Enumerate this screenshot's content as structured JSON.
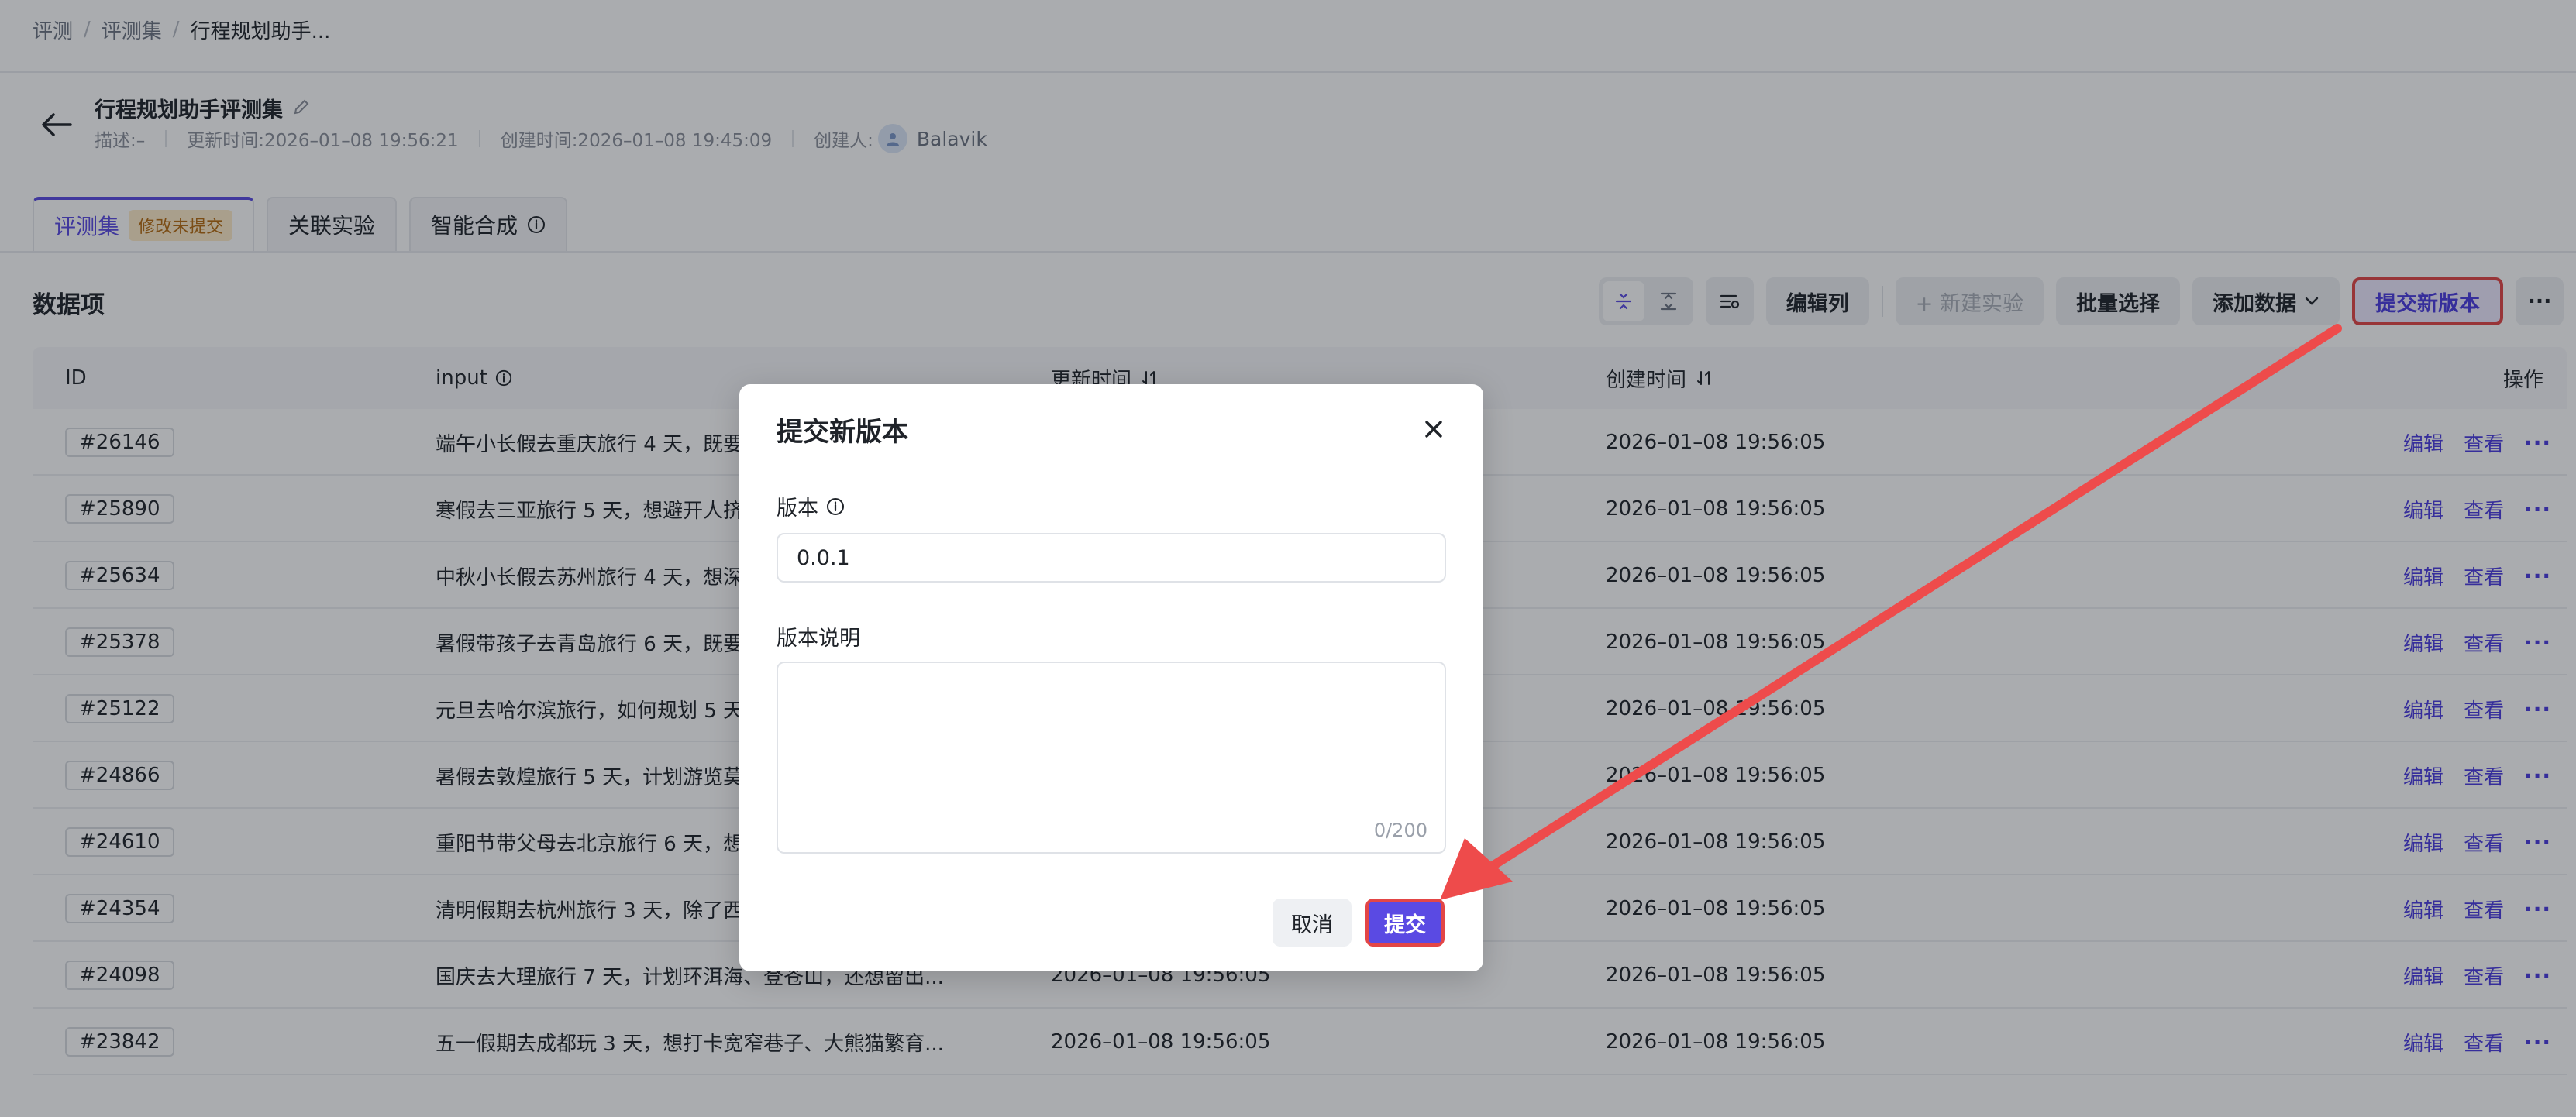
{
  "breadcrumb": {
    "items": [
      "评测",
      "评测集",
      "行程规划助手..."
    ]
  },
  "header": {
    "title": "行程规划助手评测集",
    "description": "描述:–",
    "updated": "更新时间:2026–01–08 19:56:21",
    "created": "创建时间:2026–01–08 19:45:09",
    "creator_label": "创建人:",
    "creator_name": "Balavik"
  },
  "tabs": [
    {
      "label": "评测集",
      "badge": "修改未提交"
    },
    {
      "label": "关联实验"
    },
    {
      "label": "智能合成"
    }
  ],
  "section": {
    "title": "数据项"
  },
  "toolbar": {
    "edit_columns": "编辑列",
    "new_experiment": "+ 新建实验",
    "batch_select": "批量选择",
    "add_data": "添加数据",
    "submit_version": "提交新版本",
    "more": "···"
  },
  "table": {
    "columns": {
      "id": "ID",
      "input": "input",
      "updated": "更新时间",
      "created": "创建时间",
      "actions": "操作"
    },
    "rows": [
      {
        "id": "#26146",
        "input": "端午小长假去重庆旅行 4 天，既要",
        "updated": "",
        "created": "2026–01–08 19:56:05"
      },
      {
        "id": "#25890",
        "input": "寒假去三亚旅行 5 天，想避开人挤",
        "updated": "",
        "created": "2026–01–08 19:56:05"
      },
      {
        "id": "#25634",
        "input": "中秋小长假去苏州旅行 4 天，想深",
        "updated": "",
        "created": "2026–01–08 19:56:05"
      },
      {
        "id": "#25378",
        "input": "暑假带孩子去青岛旅行 6 天，既要",
        "updated": "",
        "created": "2026–01–08 19:56:05"
      },
      {
        "id": "#25122",
        "input": "元旦去哈尔滨旅行，如何规划 5 天",
        "updated": "",
        "created": "2026–01–08 19:56:05"
      },
      {
        "id": "#24866",
        "input": "暑假去敦煌旅行 5 天，计划游览莫",
        "updated": "",
        "created": "2026–01–08 19:56:05"
      },
      {
        "id": "#24610",
        "input": "重阳节带父母去北京旅行 6 天，想",
        "updated": "",
        "created": "2026–01–08 19:56:05"
      },
      {
        "id": "#24354",
        "input": "清明假期去杭州旅行 3 天，除了西",
        "updated": "",
        "created": "2026–01–08 19:56:05"
      },
      {
        "id": "#24098",
        "input": "国庆去大理旅行 7 天，计划环洱海、登苍山，还想留出...",
        "updated": "2026–01–08 19:56:05",
        "created": "2026–01–08 19:56:05"
      },
      {
        "id": "#23842",
        "input": "五一假期去成都玩 3 天，想打卡宽窄巷子、大熊猫繁育...",
        "updated": "2026–01–08 19:56:05",
        "created": "2026–01–08 19:56:05"
      }
    ],
    "action_edit": "编辑",
    "action_view": "查看",
    "action_more": "···"
  },
  "modal": {
    "title": "提交新版本",
    "version_label": "版本",
    "version_value": "0.0.1",
    "desc_label": "版本说明",
    "char_count": "0/200",
    "cancel": "取消",
    "submit": "提交"
  },
  "colors": {
    "accent": "#5a4ae3",
    "highlight": "#e34646"
  }
}
